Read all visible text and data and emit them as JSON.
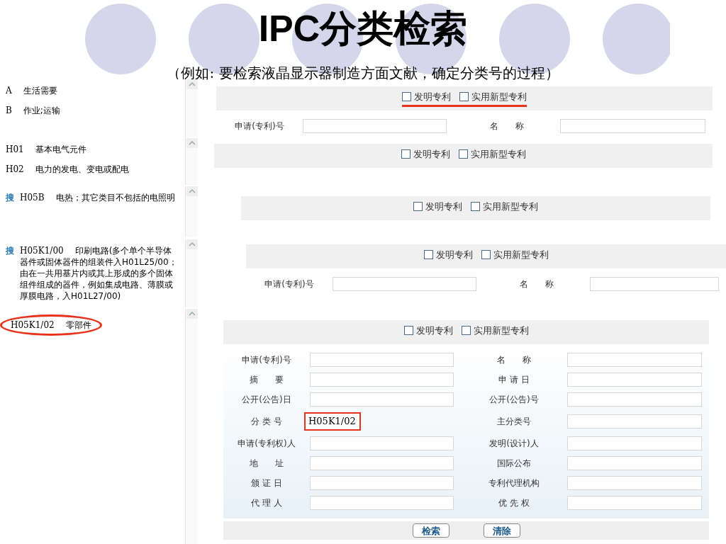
{
  "title": "IPC分类检索",
  "subtitle": "（例如: 要检索液晶显示器制造方面文献，确定分类号的过程）",
  "class_panels": [
    {
      "items": [
        {
          "code": "A",
          "name": "生活需要",
          "circled": false
        },
        {
          "code": "B",
          "name": "作业;运输",
          "circled": false
        }
      ]
    },
    {
      "items": [
        {
          "code": "H01",
          "name": "基本电气元件",
          "circled": false
        },
        {
          "code": "H02",
          "name": "电力的发电、变电或配电",
          "circled": false
        }
      ]
    },
    {
      "items": [
        {
          "search_icon": "搜",
          "code": "H05B",
          "name": "电热；其它类目不包括的电照明",
          "circled": false
        }
      ]
    },
    {
      "items": [
        {
          "search_icon": "搜",
          "code": "H05K1/00",
          "name": "印刷电路(多个单个半导体器件或固体器件的组装件入H01L25/00；由在一共用基片内或其上形成的多个固体组件组成的器件，例如集成电路、薄膜或厚膜电路，入H01L27/00)",
          "circled": false
        }
      ]
    },
    {
      "items": [
        {
          "code": "H05K1/02",
          "name": "零部件",
          "circled": true
        }
      ]
    }
  ],
  "form_snapshots": [
    {
      "underlined": true,
      "options": [
        {
          "label": "发明专利",
          "checked": false
        },
        {
          "label": "实用新型专利",
          "checked": false
        }
      ],
      "fields": [
        {
          "label": "申请(专利)号",
          "highlighted": false
        },
        {
          "label": "名　　称",
          "highlighted": false
        }
      ]
    },
    {
      "underlined": false,
      "options": [
        {
          "label": "发明专利",
          "checked": false
        },
        {
          "label": "实用新型专利",
          "checked": false
        }
      ]
    },
    {
      "underlined": false,
      "options": [
        {
          "label": "发明专利",
          "checked": false
        },
        {
          "label": "实用新型专利",
          "checked": false
        }
      ]
    },
    {
      "underlined": false,
      "options": [
        {
          "label": "发明专利",
          "checked": false
        },
        {
          "label": "实用新型专利",
          "checked": false
        }
      ],
      "fields": [
        {
          "label": "申请(专利)号",
          "highlighted": false
        },
        {
          "label": "名　　称",
          "highlighted": false
        }
      ]
    },
    {
      "underlined": false,
      "options": [
        {
          "label": "发明专利",
          "checked": false
        },
        {
          "label": "实用新型专利",
          "checked": false
        }
      ],
      "fields": [
        {
          "label": "申请(专利)号",
          "highlighted": false
        },
        {
          "label": "名　　称",
          "highlighted": false
        },
        {
          "label": "摘　　要",
          "highlighted": false
        },
        {
          "label": "申 请 日",
          "highlighted": false
        },
        {
          "label": "公开(公告)日",
          "highlighted": false
        },
        {
          "label": "公开(公告)号",
          "highlighted": false
        },
        {
          "label": "分 类 号",
          "value": "H05K1/02",
          "highlighted": true
        },
        {
          "label": "主分类号",
          "highlighted": false
        },
        {
          "label": "申请(专利权)人",
          "highlighted": false
        },
        {
          "label": "发明(设计)人",
          "highlighted": false
        },
        {
          "label": "地　　址",
          "highlighted": false
        },
        {
          "label": "国际公布",
          "highlighted": false
        },
        {
          "label": "颁 证 日",
          "highlighted": false
        },
        {
          "label": "专利代理机构",
          "highlighted": false
        },
        {
          "label": "代 理 人",
          "highlighted": false
        },
        {
          "label": "优 先 权",
          "highlighted": false
        }
      ],
      "buttons": [
        "检索",
        "清除"
      ]
    }
  ]
}
